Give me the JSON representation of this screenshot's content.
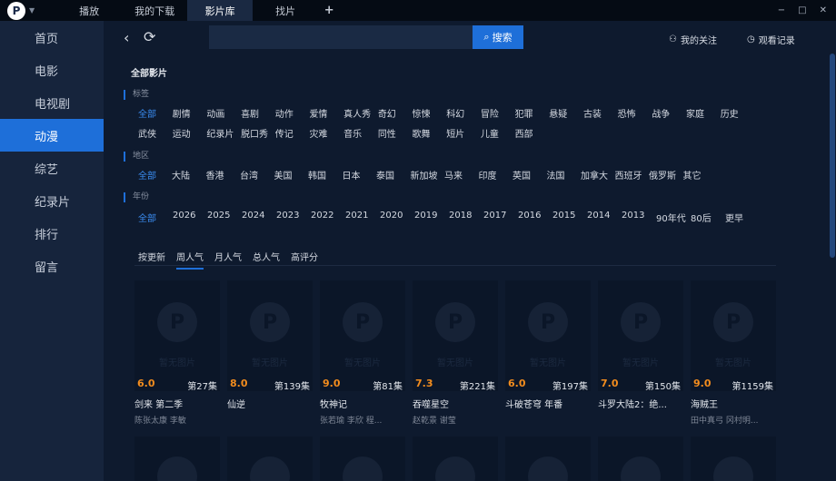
{
  "titlebar": {
    "logo": "P",
    "tabs": [
      {
        "label": "播放",
        "active": false
      },
      {
        "label": "我的下载",
        "active": false
      },
      {
        "label": "影片库",
        "active": true
      },
      {
        "label": "找片",
        "active": false
      }
    ],
    "add_tab": "+",
    "controls": {
      "minimize": "−",
      "maximize": "□",
      "close": "✕"
    }
  },
  "sidebar": {
    "items": [
      {
        "label": "首页",
        "active": false
      },
      {
        "label": "电影",
        "active": false
      },
      {
        "label": "电视剧",
        "active": false
      },
      {
        "label": "动漫",
        "active": true
      },
      {
        "label": "综艺",
        "active": false
      },
      {
        "label": "纪录片",
        "active": false
      },
      {
        "label": "排行",
        "active": false
      },
      {
        "label": "留言",
        "active": false
      }
    ]
  },
  "topbar": {
    "search_value": "",
    "search_button": "搜索",
    "follow": "我的关注",
    "history": "观看记录"
  },
  "library_title": "全部影片",
  "filters": {
    "genre": {
      "label": "标签",
      "options": [
        "全部",
        "剧情",
        "动画",
        "喜剧",
        "动作",
        "爱情",
        "真人秀",
        "奇幻",
        "惊悚",
        "科幻",
        "冒险",
        "犯罪",
        "悬疑",
        "古装",
        "恐怖",
        "战争",
        "家庭",
        "历史",
        "武侠",
        "运动",
        "纪录片",
        "脱口秀",
        "传记",
        "灾难",
        "音乐",
        "同性",
        "歌舞",
        "短片",
        "儿童",
        "西部"
      ],
      "selected": "全部"
    },
    "region": {
      "label": "地区",
      "options": [
        "全部",
        "大陆",
        "香港",
        "台湾",
        "美国",
        "韩国",
        "日本",
        "泰国",
        "新加坡",
        "马来",
        "印度",
        "英国",
        "法国",
        "加拿大",
        "西班牙",
        "俄罗斯",
        "其它"
      ],
      "selected": "全部"
    },
    "year": {
      "label": "年份",
      "options": [
        "全部",
        "2026",
        "2025",
        "2024",
        "2023",
        "2022",
        "2021",
        "2020",
        "2019",
        "2018",
        "2017",
        "2016",
        "2015",
        "2014",
        "2013",
        "90年代",
        "80后",
        "更早"
      ],
      "selected": "全部"
    }
  },
  "sort_tabs": {
    "options": [
      "按更新",
      "周人气",
      "月人气",
      "总人气",
      "高评分"
    ],
    "selected": "周人气"
  },
  "poster_placeholder": "暂无图片",
  "cards": [
    {
      "score": "6.0",
      "episodes": "第27集",
      "title": "剑来 第二季",
      "cast": "陈张太康 李敏"
    },
    {
      "score": "8.0",
      "episodes": "第139集",
      "title": "仙逆",
      "cast": ""
    },
    {
      "score": "9.0",
      "episodes": "第81集",
      "title": "牧神记",
      "cast": "张若瑜 李欣 程..."
    },
    {
      "score": "7.3",
      "episodes": "第221集",
      "title": "吞噬星空",
      "cast": "赵乾景 谢莹"
    },
    {
      "score": "6.0",
      "episodes": "第197集",
      "title": "斗破苍穹 年番",
      "cast": ""
    },
    {
      "score": "7.0",
      "episodes": "第150集",
      "title": "斗罗大陆2：绝...",
      "cast": ""
    },
    {
      "score": "9.0",
      "episodes": "第1159集",
      "title": "海贼王",
      "cast": "田中真弓 冈村明..."
    }
  ],
  "colors": {
    "accent": "#1e6fd9",
    "score": "#f28c1e",
    "background": "#0e1a2e",
    "sidebar": "#16243c"
  }
}
